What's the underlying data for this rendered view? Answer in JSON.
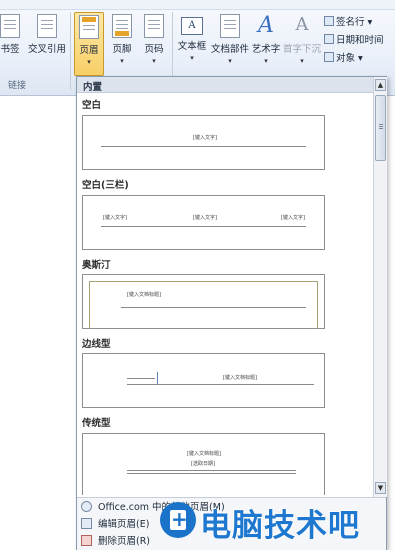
{
  "ribbon": {
    "buttons": [
      {
        "label": "书签"
      },
      {
        "label": "交叉引用"
      },
      {
        "label": "页眉"
      },
      {
        "label": "页脚"
      },
      {
        "label": "页码"
      },
      {
        "label": "文本框"
      },
      {
        "label": "文档部件"
      },
      {
        "label": "艺术字"
      },
      {
        "label": "首字下沉"
      }
    ],
    "side_items": [
      {
        "label": "签名行"
      },
      {
        "label": "日期和时间"
      },
      {
        "label": "对象"
      }
    ],
    "group_label": "链接",
    "dropdown_arrow": "▾",
    "accent_color": "#f8cf68"
  },
  "gallery": {
    "header": "内置",
    "sections": [
      {
        "title": "空白",
        "placeholders": [
          "[键入文字]"
        ]
      },
      {
        "title": "空白(三栏)",
        "placeholders": [
          "[键入文字]",
          "[键入文字]",
          "[键入文字]"
        ]
      },
      {
        "title": "奥斯汀",
        "placeholders": [
          "[键入文档标题]"
        ]
      },
      {
        "title": "边线型",
        "placeholders": [
          "[键入文档标题]"
        ]
      },
      {
        "title": "传统型",
        "placeholders": [
          "[键入文档标题]",
          "[选取日期]"
        ]
      }
    ],
    "scroll_up": "▲",
    "scroll_down": "▼"
  },
  "menu": {
    "items": [
      {
        "label": "Office.com 中的其他页眉(M)"
      },
      {
        "label": "编辑页眉(E)"
      },
      {
        "label": "删除页眉(R)"
      }
    ]
  },
  "watermark": {
    "text": "电脑技术吧",
    "color": "#1e78cf"
  }
}
